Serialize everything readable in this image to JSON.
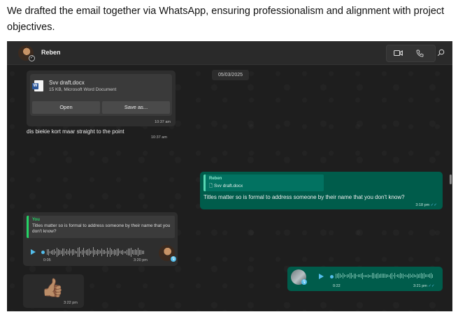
{
  "caption": "We drafted the email together via WhatsApp, ensuring professionalism and alignment with project objectives.",
  "header": {
    "contact_name": "Reben",
    "icons": {
      "video": "video-call-icon",
      "phone": "voice-call-icon",
      "search": "search-icon"
    }
  },
  "chat": {
    "date_chip": "05/03/2025",
    "document": {
      "file_name": "Svv draft.docx",
      "file_meta": "15 KB, Microsoft Word Document",
      "open_label": "Open",
      "save_label": "Save as...",
      "time": "10:37 am"
    },
    "incoming_text": {
      "text": "dis biekie kort maar straight to the point",
      "time": "10:37 am"
    },
    "outgoing_quote": {
      "quote_author": "Reben",
      "quote_file": "Svv draft.docx",
      "text": "Titles matter so is formal to address someone by their name that you don't know?",
      "time": "3:18 pm"
    },
    "incoming_voice": {
      "quote_author": "You",
      "quote_text": "Titles matter so is formal to address someone by their name that you don't know?",
      "duration": "0:05",
      "time": "3:20 pm"
    },
    "outgoing_voice": {
      "duration": "0:22",
      "time": "3:21 pm"
    },
    "sticker": {
      "emoji": "👍🏽",
      "time": "3:22 pm"
    }
  },
  "colors": {
    "app_bg": "#1e1e1e",
    "incoming_bubble": "#2e2e2e",
    "outgoing_bubble": "#005c4b",
    "accent_blue": "#53bdeb",
    "accent_green": "#25d366"
  }
}
